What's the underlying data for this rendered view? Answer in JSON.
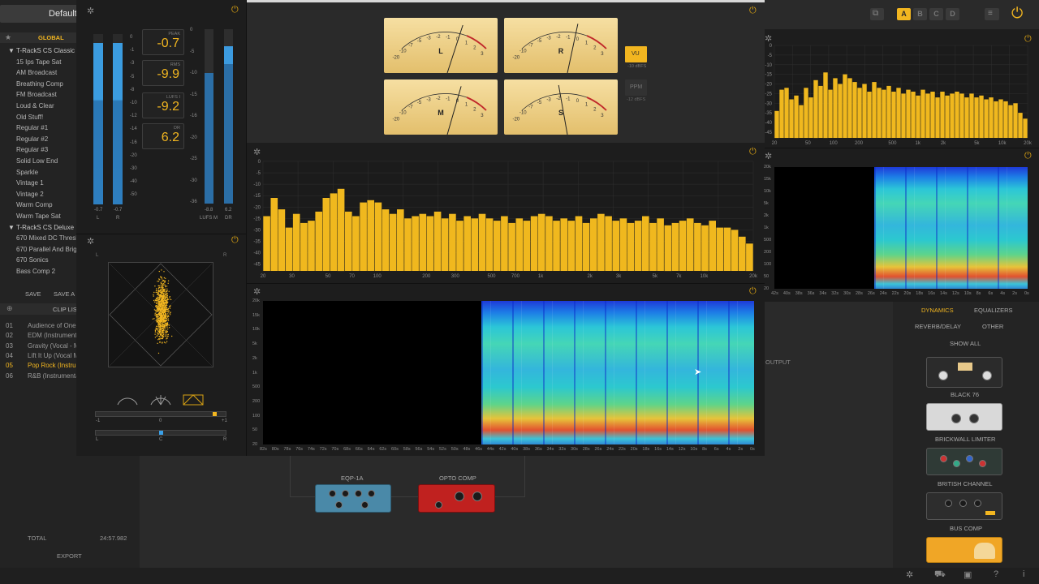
{
  "preset_name": "Default",
  "sidebar": {
    "header": "GLOBAL",
    "groups": [
      {
        "label": "▼ T-RackS CS Classic",
        "items": [
          "15 Ips Tape Sat",
          "AM Broadcast",
          "Breathing Comp",
          "FM Broadcast",
          "Loud & Clear",
          "Old Stuff!",
          "Regular #1",
          "Regular #2",
          "Regular #3",
          "Solid Low End",
          "Sparkle",
          "Vintage 1",
          "Vintage 2",
          "Warm Comp",
          "Warm Tape Sat"
        ]
      },
      {
        "label": "▼ T-RackS CS Deluxe",
        "items": [
          "670 Mixed DC Thresh",
          "670 Parallel And Brig",
          "670 Sonics",
          "Bass Comp 2"
        ]
      }
    ],
    "save": "SAVE",
    "save_as": "SAVE A",
    "cliplist_title": "CLIP LIS",
    "clips": [
      {
        "num": "01",
        "name": "Audience of One (",
        "active": false
      },
      {
        "num": "02",
        "name": "EDM (Instrumenta",
        "active": false
      },
      {
        "num": "03",
        "name": "Gravity (Vocal - M",
        "active": false
      },
      {
        "num": "04",
        "name": "Lift It Up (Vocal M",
        "active": false
      },
      {
        "num": "05",
        "name": "Pop Rock (Instrum",
        "active": true
      },
      {
        "num": "06",
        "name": "R&B (Instrumenta",
        "active": false
      }
    ],
    "total_label": "TOTAL",
    "total_value": "24:57.982",
    "export": "EXPORT"
  },
  "meters": {
    "left_scale": [
      "0",
      "-1",
      "-3",
      "-5",
      "-8",
      "-10",
      "-12",
      "-14",
      "-16",
      "-20",
      "-30",
      "-40",
      "-50"
    ],
    "peak": {
      "label": "PEAK",
      "value": "-0.7"
    },
    "rms": {
      "label": "RMS",
      "value": "-9.9"
    },
    "lufs": {
      "label": "LUFS I",
      "value": "-9.2"
    },
    "dr": {
      "label": "DR",
      "value": "6.2"
    },
    "right_scale": [
      "0",
      "-5",
      "-10",
      "-15",
      "-16",
      "-20",
      "-25",
      "-30",
      "-36"
    ],
    "l_val": "-0.7",
    "r_val": "-0.7",
    "l": "L",
    "r": "R",
    "lufs_m_val": "-8.8",
    "dr_val": "6.2",
    "lufs_m": "LUFS M",
    "dr_lbl": "DR",
    "l_level": 0.95,
    "r_level": 0.95,
    "lufsm_level": 0.75,
    "dr_level": 0.85
  },
  "vu": {
    "meters": [
      "L",
      "R",
      "M",
      "S"
    ],
    "scale": [
      "-20",
      "-10",
      "-7",
      "-5",
      "-3",
      "-2",
      "-1",
      "0",
      "1",
      "2",
      "3"
    ],
    "vu_label": "VU",
    "vu_sub": "-10 dBFS",
    "ppm_label": "PPM",
    "ppm_sub": "-12 dBFS"
  },
  "vectorscope": {
    "l": "L",
    "r": "R",
    "corr_scale": [
      "-1",
      "0",
      "+1"
    ],
    "bal_scale": [
      "L",
      "C",
      "R"
    ],
    "corr_value": 0.85,
    "bal_value": 0.0
  },
  "spectrum_main": {
    "yticks": [
      "0",
      "-5",
      "-10",
      "-15",
      "-20",
      "-25",
      "-30",
      "-35",
      "-40",
      "-45"
    ],
    "xticks": [
      "20",
      "30",
      "50",
      "70",
      "100",
      "200",
      "300",
      "500",
      "700",
      "1k",
      "2k",
      "3k",
      "5k",
      "7k",
      "10k",
      "20k"
    ],
    "bars": [
      -24,
      -16,
      -21,
      -29,
      -23,
      -27,
      -26,
      -22,
      -16,
      -14,
      -12,
      -22,
      -24,
      -18,
      -17,
      -18,
      -21,
      -23,
      -21,
      -25,
      -24,
      -23,
      -24,
      -22,
      -25,
      -23,
      -26,
      -24,
      -25,
      -23,
      -25,
      -26,
      -24,
      -27,
      -25,
      -26,
      -24,
      -23,
      -24,
      -26,
      -25,
      -26,
      -24,
      -27,
      -25,
      -23,
      -24,
      -26,
      -25,
      -27,
      -26,
      -24,
      -27,
      -25,
      -28,
      -27,
      -26,
      -25,
      -27,
      -28,
      -26,
      -29,
      -29,
      -30,
      -33,
      -36
    ],
    "ymin": -48,
    "ymax": 0
  },
  "spectrum_small": {
    "yticks": [
      "0",
      "-5",
      "-10",
      "-15",
      "-20",
      "-25",
      "-30",
      "-35",
      "-40",
      "-45"
    ],
    "xticks": [
      "20",
      "50",
      "100",
      "200",
      "500",
      "1k",
      "2k",
      "5k",
      "10k",
      "20k"
    ],
    "bars": [
      -34,
      -23,
      -22,
      -28,
      -26,
      -31,
      -22,
      -27,
      -18,
      -21,
      -14,
      -23,
      -17,
      -20,
      -15,
      -17,
      -19,
      -22,
      -20,
      -24,
      -19,
      -22,
      -23,
      -21,
      -24,
      -22,
      -25,
      -23,
      -24,
      -26,
      -23,
      -25,
      -24,
      -27,
      -24,
      -26,
      -25,
      -24,
      -25,
      -27,
      -25,
      -27,
      -26,
      -28,
      -27,
      -29,
      -28,
      -29,
      -31,
      -30,
      -35,
      -38
    ],
    "ymin": -48,
    "ymax": 0
  },
  "spectrogram_main": {
    "yticks": [
      "20k",
      "15k",
      "10k",
      "5k",
      "2k",
      "1k",
      "500",
      "200",
      "100",
      "50",
      "20"
    ],
    "xticks": [
      "82s",
      "80s",
      "78s",
      "76s",
      "74s",
      "72s",
      "70s",
      "68s",
      "66s",
      "64s",
      "62s",
      "60s",
      "58s",
      "56s",
      "54s",
      "52s",
      "50s",
      "48s",
      "46s",
      "44s",
      "42s",
      "40s",
      "38s",
      "36s",
      "34s",
      "32s",
      "30s",
      "28s",
      "26s",
      "24s",
      "22s",
      "20s",
      "18s",
      "16s",
      "14s",
      "12s",
      "10s",
      "8s",
      "6s",
      "4s",
      "2s",
      "0s"
    ]
  },
  "spectrogram_small": {
    "yticks": [
      "20k",
      "15k",
      "10k",
      "5k",
      "2k",
      "1k",
      "500",
      "200",
      "100",
      "50",
      "20"
    ],
    "xticks": [
      "42s",
      "40s",
      "38s",
      "36s",
      "34s",
      "32s",
      "30s",
      "28s",
      "26s",
      "24s",
      "22s",
      "20s",
      "18s",
      "16s",
      "14s",
      "12s",
      "10s",
      "8s",
      "6s",
      "4s",
      "2s",
      "0s"
    ]
  },
  "top_bar": {
    "snapshots": [
      "A",
      "B",
      "C",
      "D"
    ],
    "active": "A"
  },
  "chain": {
    "modules": [
      {
        "name": "EQP-1A"
      },
      {
        "name": "OPTO COMP"
      }
    ],
    "output": "OUTPUT"
  },
  "browser": {
    "tabs": [
      "DYNAMICS",
      "EQUALIZERS",
      "REVERB/DELAY",
      "OTHER"
    ],
    "active_tab": "DYNAMICS",
    "show_all": "SHOW ALL",
    "plugins": [
      {
        "name": "BLACK 76"
      },
      {
        "name": "BRICKWALL LIMITER"
      },
      {
        "name": "BRITISH CHANNEL"
      },
      {
        "name": "BUS COMP"
      }
    ]
  },
  "colors": {
    "accent": "#f2b620",
    "bar": "#f0b81e",
    "meter_blue": "#2d8ed6",
    "eqp": "#3f7a97",
    "opto": "#b81b1f"
  }
}
